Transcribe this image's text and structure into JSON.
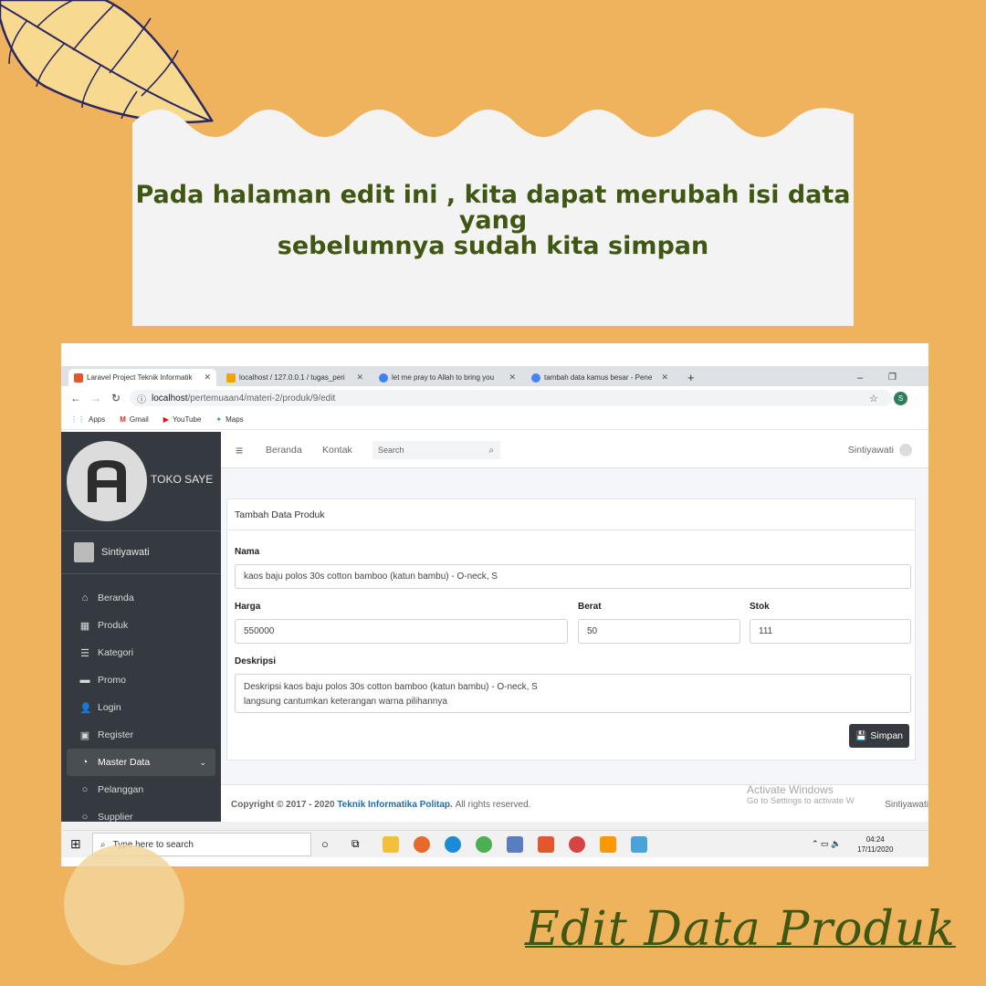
{
  "caption": {
    "line1": "Pada halaman edit ini , kita dapat merubah isi data yang",
    "line2": "sebelumnya  sudah kita simpan"
  },
  "browser": {
    "tabs": [
      {
        "label": "Laravel Project Teknik Informatik",
        "color": "#e4572e"
      },
      {
        "label": "localhost / 127.0.0.1 / tugas_peri",
        "color": "#f0a500"
      },
      {
        "label": "let me pray to Allah to bring you",
        "color": "#3b82f6"
      },
      {
        "label": "tambah data kamus besar - Pene",
        "color": "#4285f4"
      }
    ],
    "url_prefix": "localhost",
    "url_path": "/pertemuaan4/materi-2/produk/9/edit",
    "profile_initial": "S",
    "bookmarks": [
      "Apps",
      "Gmail",
      "YouTube",
      "Maps"
    ]
  },
  "sidebar": {
    "brand": "TOKO SAYE",
    "user": "Sintiyawati",
    "items": [
      {
        "label": "Beranda",
        "icon": "home-icon",
        "glyph": "⌂"
      },
      {
        "label": "Produk",
        "icon": "grid-icon",
        "glyph": "▦"
      },
      {
        "label": "Kategori",
        "icon": "list-icon",
        "glyph": "☰"
      },
      {
        "label": "Promo",
        "icon": "card-icon",
        "glyph": "▬"
      },
      {
        "label": "Login",
        "icon": "user-icon",
        "glyph": "👤"
      },
      {
        "label": "Register",
        "icon": "id-card-icon",
        "glyph": "▣"
      },
      {
        "label": "Master Data",
        "icon": "dashboard-icon",
        "glyph": "◔"
      },
      {
        "label": "Pelanggan",
        "icon": "circle-icon",
        "glyph": "○"
      },
      {
        "label": "Supplier",
        "icon": "circle-icon",
        "glyph": "○"
      }
    ]
  },
  "topnav": {
    "menu_glyph": "≡",
    "links": [
      "Beranda",
      "Kontak"
    ],
    "search_placeholder": "Search",
    "user": "Sintiyawati"
  },
  "form": {
    "card_title": "Tambah Data Produk",
    "nama_label": "Nama",
    "nama_value": "kaos baju polos 30s cotton bamboo (katun bambu) - O-neck, S",
    "harga_label": "Harga",
    "harga_value": "550000",
    "berat_label": "Berat",
    "berat_value": "50",
    "stok_label": "Stok",
    "stok_value": "111",
    "deskripsi_label": "Deskripsi",
    "deskripsi_line1": "Deskripsi kaos baju polos 30s cotton bamboo (katun bambu) - O-neck, S",
    "deskripsi_line2": "langsung cantumkan keterangan warna pilihannya",
    "submit_label": "Simpan"
  },
  "footer": {
    "prefix": "Copyright © 2017 - 2020",
    "org": "Teknik Informatika Politap.",
    "suffix": "All rights reserved.",
    "activate_title": "Activate Windows",
    "activate_sub": "Go to Settings to activate W",
    "right_user": "Sintiyawati"
  },
  "taskbar": {
    "search_placeholder": "Type here to search",
    "time": "04:24",
    "date": "17/11/2020"
  },
  "page_title": "Edit Data Produk",
  "colors": {
    "background": "#efb35d",
    "caption_text": "#3f5713",
    "sidebar": "#343a40"
  }
}
